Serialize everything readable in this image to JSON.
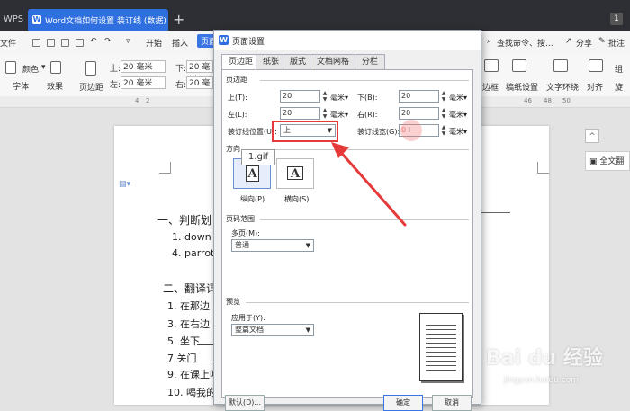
{
  "titlebar": {
    "app_tab": "WPS",
    "doc_tab": "Word文档如何设置 装订线 (数据)",
    "new_tab": "+",
    "badge": "1"
  },
  "menubar": {
    "file": "文件",
    "start": "开始",
    "insert": "插入",
    "active": "页面布",
    "search": "查找命令、搜...",
    "share": "分享",
    "comment": "批注"
  },
  "ribbon": {
    "color": "颜色",
    "font": "字体",
    "effect": "效果",
    "margin": "页边距",
    "top_label": "上:",
    "top_value": "20 毫米",
    "bottom_label": "下:",
    "bottom_value": "20 毫米",
    "left_label": "左:",
    "left_value": "20 毫米",
    "right_label": "右:",
    "right_value": "20 毫",
    "border": "边框",
    "paper_setup": "稿纸设置",
    "wrap": "文字环绕",
    "align": "对齐",
    "rotate": "旋",
    "group": "组"
  },
  "ruler": {
    "ticks": [
      "4",
      "2",
      "46",
      "48",
      "50"
    ]
  },
  "document": {
    "section1": "一、判断划",
    "item1": "1. down",
    "item4": "4. parrot",
    "section2": "二、翻译词",
    "lines": [
      "1. 在那边",
      "3. 在右边",
      "5. 坐下",
      "7 关门",
      "9. 在课上吃",
      "10. 喝我的"
    ]
  },
  "right_panel": {
    "collapse": "^",
    "fulltext": "全文翻"
  },
  "dialog": {
    "title": "页面设置",
    "tabs": [
      "页边距",
      "纸张",
      "版式",
      "文档网格",
      "分栏"
    ],
    "margins_section": "页边距",
    "top_label": "上(T):",
    "top_value": "20",
    "bottom_label": "下(B):",
    "bottom_value": "20",
    "left_label": "左(L):",
    "left_value": "20",
    "right_label": "右(R):",
    "right_value": "20",
    "unit": "毫米",
    "gutter_pos_label": "装订线位置(U):",
    "gutter_pos_value": "上",
    "gutter_width_label": "装订线宽(G):",
    "gutter_width_value": "0",
    "orientation_section": "方向",
    "portrait": "纵向(P)",
    "landscape": "横向(S)",
    "pages_section": "页码范围",
    "multi_pages_label": "多页(M):",
    "multi_pages_value": "普通",
    "preview_section": "预览",
    "apply_label": "应用于(Y):",
    "apply_value": "整篇文档",
    "default_button": "默认(D)...",
    "ok_button": "确定",
    "cancel_button": "取消"
  },
  "tooltip": "1.gif",
  "watermark": {
    "brand": "Bai du 经验",
    "url": "jingyan.baidu.com"
  },
  "colors": {
    "accent": "#2f6fe0",
    "highlight": "#e5393a"
  }
}
